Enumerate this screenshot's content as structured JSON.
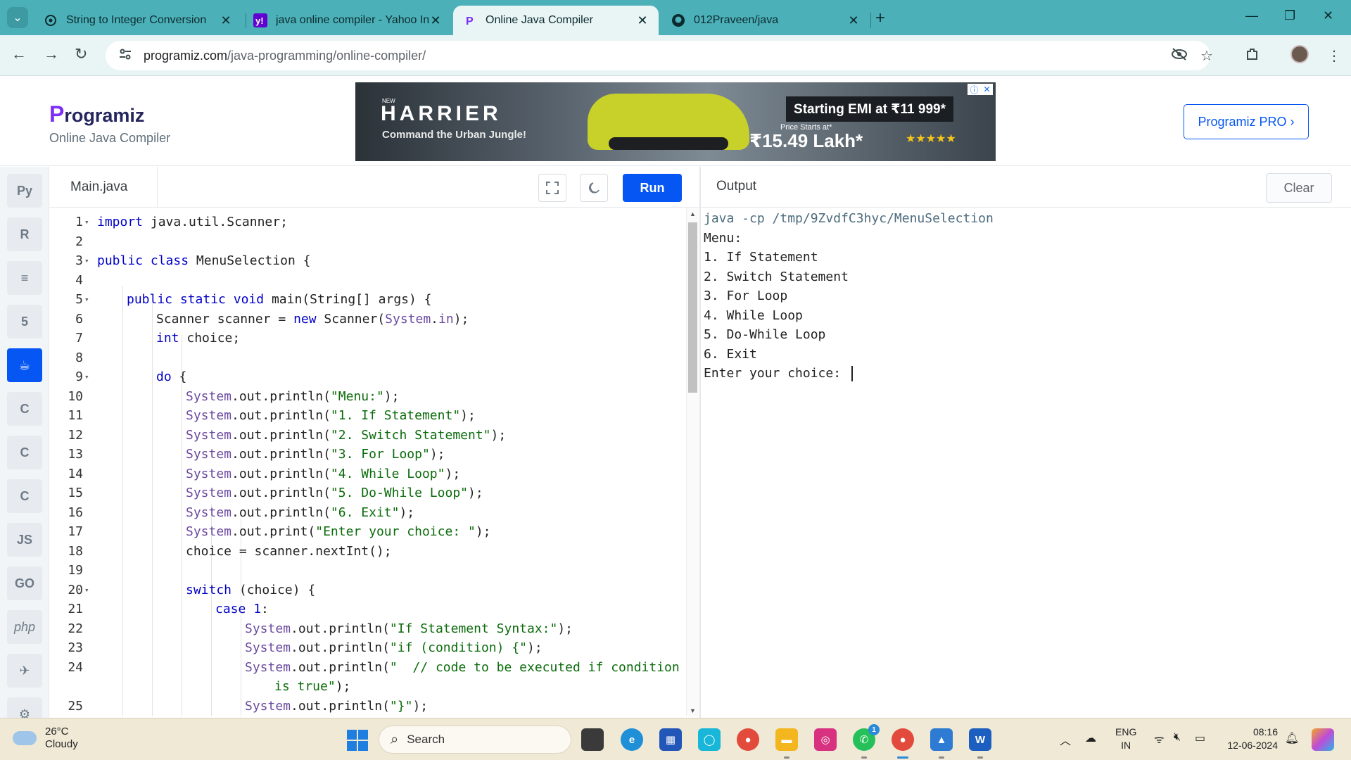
{
  "browser": {
    "tabs": [
      {
        "title": "String to Integer Conversion",
        "favicon": "chatgpt-icon",
        "active": false
      },
      {
        "title": "java online compiler - Yahoo In",
        "favicon": "yahoo-icon",
        "active": false
      },
      {
        "title": "Online Java Compiler",
        "favicon": "programiz-icon",
        "active": true
      },
      {
        "title": "012Praveen/java",
        "favicon": "github-icon",
        "active": false
      }
    ],
    "url_host": "programiz.com",
    "url_path": "/java-programming/online-compiler/"
  },
  "site": {
    "logo": "rogramiz",
    "logo_letter": "P",
    "subtitle": "Online Java Compiler",
    "pro_button": "Programiz PRO ›"
  },
  "ad": {
    "brand_top": "NEW",
    "brand": "HARRIER",
    "tagline": "Command the Urban Jungle!",
    "emi": "Starting EMI at ₹11 999*",
    "price_label": "Price Starts at*",
    "price": "₹15.49 Lakh*",
    "stars": "★★★★★"
  },
  "sidebar": {
    "languages": [
      {
        "name": "python",
        "glyph": "Py"
      },
      {
        "name": "r",
        "glyph": "R"
      },
      {
        "name": "sql",
        "glyph": "≡"
      },
      {
        "name": "html",
        "glyph": "5"
      },
      {
        "name": "java",
        "glyph": "☕",
        "active": true
      },
      {
        "name": "c",
        "glyph": "C"
      },
      {
        "name": "cpp",
        "glyph": "C"
      },
      {
        "name": "csharp",
        "glyph": "C"
      },
      {
        "name": "javascript",
        "glyph": "JS"
      },
      {
        "name": "go",
        "glyph": "GO"
      },
      {
        "name": "php",
        "glyph": "php"
      },
      {
        "name": "swift",
        "glyph": "✈"
      },
      {
        "name": "rust",
        "glyph": "⚙"
      }
    ]
  },
  "editor": {
    "filename": "Main.java",
    "run_label": "Run",
    "lines": [
      {
        "n": "1",
        "fold": true,
        "indent": 0,
        "text": "import java.util.Scanner;"
      },
      {
        "n": "2",
        "fold": false,
        "indent": 0,
        "text": ""
      },
      {
        "n": "3",
        "fold": true,
        "indent": 0,
        "text": "public class MenuSelection {"
      },
      {
        "n": "4",
        "fold": false,
        "indent": 0,
        "text": ""
      },
      {
        "n": "5",
        "fold": true,
        "indent": 1,
        "text": "public static void main(String[] args) {"
      },
      {
        "n": "6",
        "fold": false,
        "indent": 2,
        "text": "Scanner scanner = new Scanner(System.in);"
      },
      {
        "n": "7",
        "fold": false,
        "indent": 2,
        "text": "int choice;"
      },
      {
        "n": "8",
        "fold": false,
        "indent": 0,
        "text": ""
      },
      {
        "n": "9",
        "fold": true,
        "indent": 2,
        "text": "do {"
      },
      {
        "n": "10",
        "fold": false,
        "indent": 3,
        "text": "System.out.println(\"Menu:\");"
      },
      {
        "n": "11",
        "fold": false,
        "indent": 3,
        "text": "System.out.println(\"1. If Statement\");"
      },
      {
        "n": "12",
        "fold": false,
        "indent": 3,
        "text": "System.out.println(\"2. Switch Statement\");"
      },
      {
        "n": "13",
        "fold": false,
        "indent": 3,
        "text": "System.out.println(\"3. For Loop\");"
      },
      {
        "n": "14",
        "fold": false,
        "indent": 3,
        "text": "System.out.println(\"4. While Loop\");"
      },
      {
        "n": "15",
        "fold": false,
        "indent": 3,
        "text": "System.out.println(\"5. Do-While Loop\");"
      },
      {
        "n": "16",
        "fold": false,
        "indent": 3,
        "text": "System.out.println(\"6. Exit\");"
      },
      {
        "n": "17",
        "fold": false,
        "indent": 3,
        "text": "System.out.print(\"Enter your choice: \");"
      },
      {
        "n": "18",
        "fold": false,
        "indent": 3,
        "text": "choice = scanner.nextInt();"
      },
      {
        "n": "19",
        "fold": false,
        "indent": 0,
        "text": ""
      },
      {
        "n": "20",
        "fold": true,
        "indent": 3,
        "text": "switch (choice) {"
      },
      {
        "n": "21",
        "fold": false,
        "indent": 4,
        "text": "case 1:"
      },
      {
        "n": "22",
        "fold": false,
        "indent": 5,
        "text": "System.out.println(\"If Statement Syntax:\");"
      },
      {
        "n": "23",
        "fold": false,
        "indent": 5,
        "text": "System.out.println(\"if (condition) {\");"
      },
      {
        "n": "24",
        "fold": false,
        "indent": 5,
        "text": "System.out.println(\"  // code to be executed if condition"
      },
      {
        "n": "",
        "fold": false,
        "indent": 6,
        "text": "is true\");"
      },
      {
        "n": "25",
        "fold": false,
        "indent": 5,
        "text": "System.out.println(\"}\");"
      }
    ]
  },
  "output": {
    "title": "Output",
    "clear_label": "Clear",
    "lines": [
      "java -cp /tmp/9ZvdfC3hyc/MenuSelection",
      "Menu:",
      "1. If Statement",
      "2. Switch Statement",
      "3. For Loop",
      "4. While Loop",
      "5. Do-While Loop",
      "6. Exit",
      "Enter your choice: "
    ]
  },
  "taskbar": {
    "weather_temp": "26°C",
    "weather_desc": "Cloudy",
    "search_placeholder": "Search",
    "whatsapp_badge": "1",
    "lang_top": "ENG",
    "lang_bottom": "IN",
    "time": "08:16",
    "date": "12-06-2024"
  },
  "colors": {
    "accent": "#0556f3",
    "tabstrip": "#4cb0b8",
    "taskbar": "#efe9d6"
  }
}
